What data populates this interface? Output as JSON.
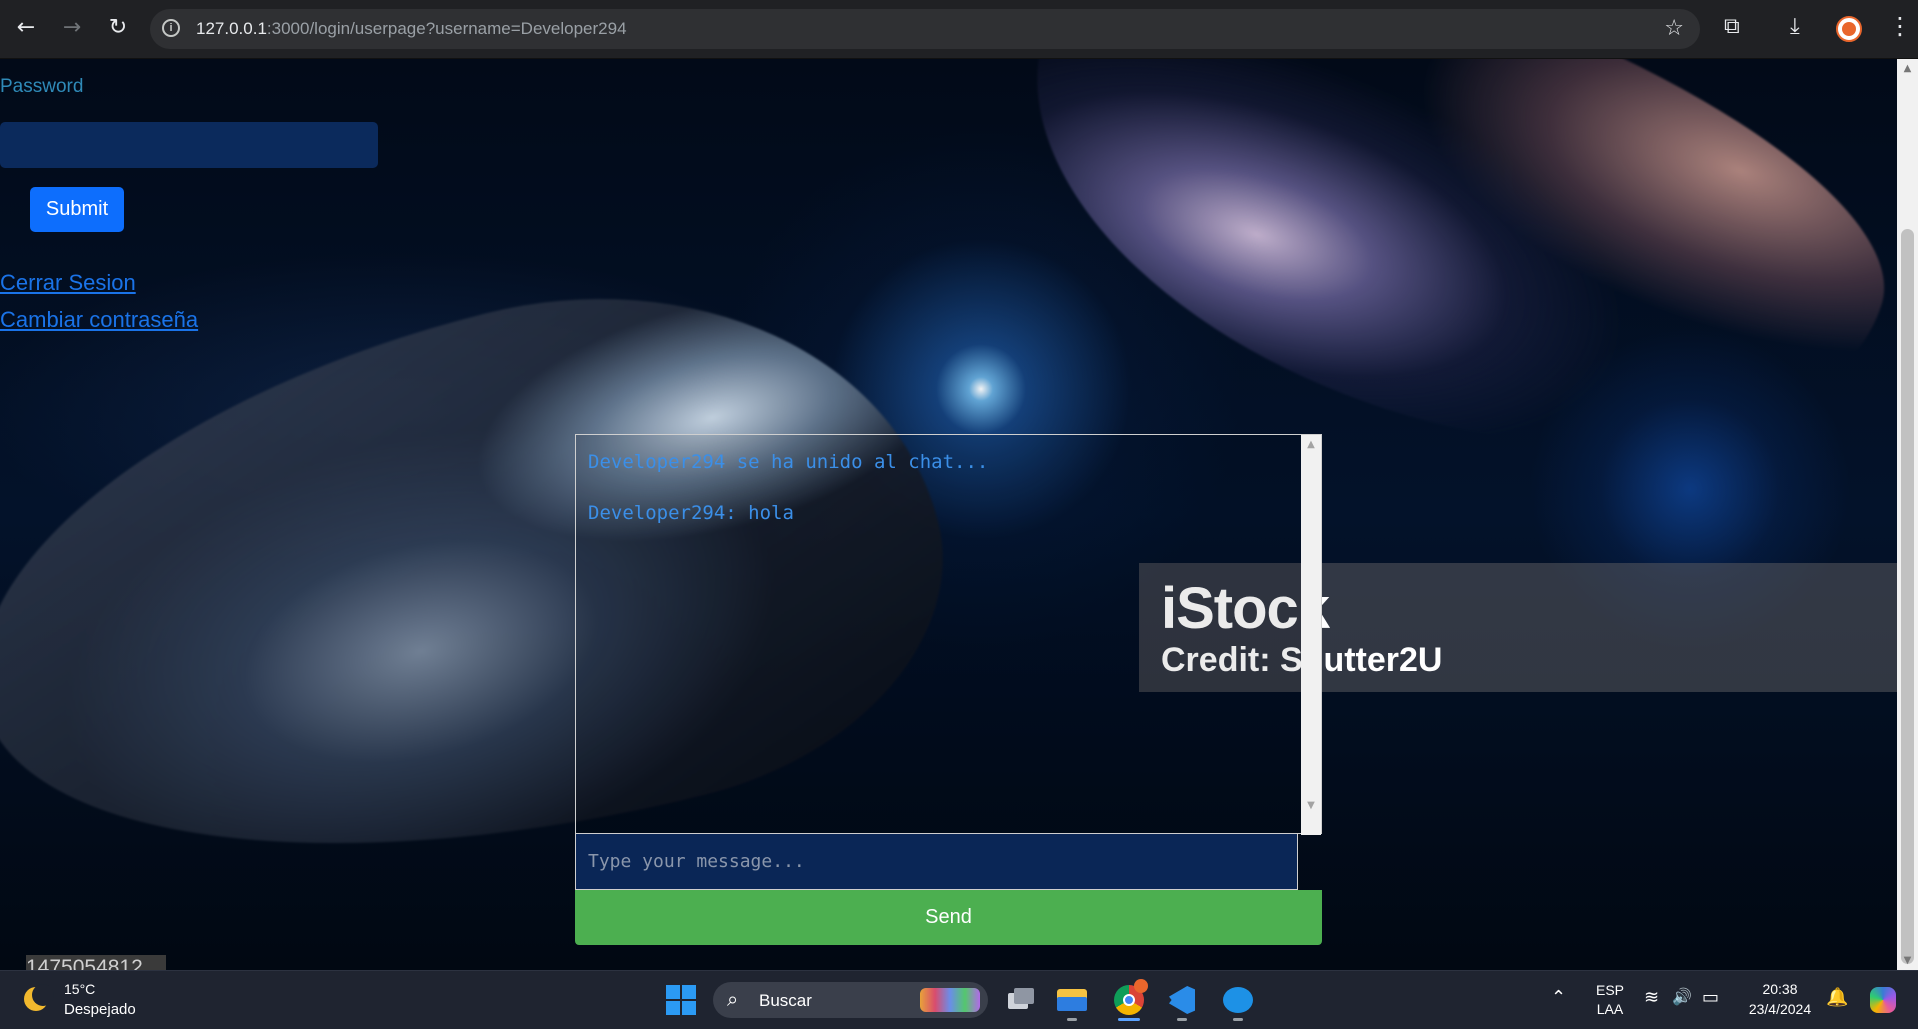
{
  "browser": {
    "url_host": "127.0.0.1",
    "url_rest": ":3000/login/userpage?username=Developer294",
    "back_icon": "←",
    "forward_icon": "→",
    "reload_icon": "↻",
    "info_icon": "i",
    "star_icon": "☆",
    "extensions_icon": "⧉",
    "download_icon": "⤓",
    "menu_icon": "⋮"
  },
  "form": {
    "password_label": "Password",
    "password_value": "",
    "submit_label": "Submit"
  },
  "links": {
    "logout": "Cerrar Sesion",
    "change_password": "Cambiar contraseña"
  },
  "watermark": {
    "logo": "iStock",
    "credit": "Credit: Shutter2U"
  },
  "chat": {
    "messages": [
      "Developer294 se ha unido al chat...",
      "Developer294: hola"
    ],
    "input_value": "",
    "input_placeholder": "Type your message...",
    "send_label": "Send"
  },
  "page_bottom_text": "1475054812",
  "taskbar": {
    "temperature": "15°C",
    "condition": "Despejado",
    "search_label": "Buscar",
    "search_icon": "⌕",
    "language_top": "ESP",
    "language_bottom": "LAA",
    "time": "20:38",
    "date": "23/4/2024",
    "up_arrow": "⌃",
    "wifi_icon": "≋",
    "volume_icon": "🔊",
    "battery_icon": "▭"
  },
  "colors": {
    "submit": "#0d6efd",
    "send": "#4caf50",
    "link": "#1a73e8",
    "chat_text": "#3b8fe8"
  }
}
